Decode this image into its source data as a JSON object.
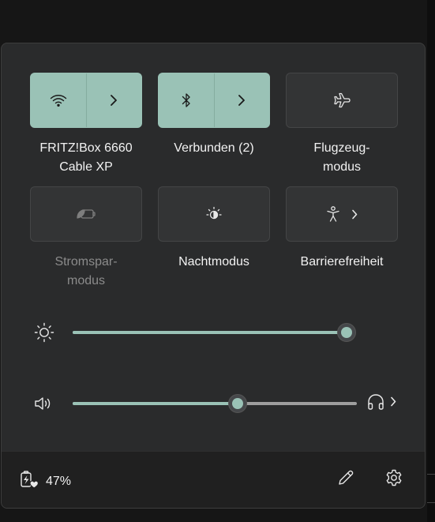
{
  "quick_settings": {
    "wifi": {
      "label": "FRITZ!Box 6660\nCable XP",
      "line1": "FRITZ!Box 6660",
      "line2": "Cable XP",
      "icon": "wifi-icon",
      "active": true
    },
    "bluetooth": {
      "label": "Verbunden (2)",
      "icon": "bluetooth-icon",
      "active": true
    },
    "airplane": {
      "line1": "Flugzeug-",
      "line2": "modus",
      "icon": "airplane-icon",
      "active": false
    },
    "battery_saver": {
      "line1": "Stromspar-",
      "line2": "modus",
      "icon": "battery-saver-icon",
      "active": false,
      "disabled": true
    },
    "night_light": {
      "label": "Nachtmodus",
      "icon": "night-light-icon",
      "active": false
    },
    "accessibility": {
      "label": "Barrierefreiheit",
      "icon": "accessibility-icon",
      "active": false
    }
  },
  "sliders": {
    "brightness": {
      "icon": "brightness-icon",
      "value": 1.0
    },
    "volume": {
      "icon": "speaker-icon",
      "value": 0.58,
      "output_icon": "headphones-icon"
    }
  },
  "footer": {
    "battery_percent": "47%",
    "battery_icon": "battery-charging-icon",
    "edit_icon": "pencil-icon",
    "settings_icon": "gear-icon"
  },
  "colors": {
    "accent": "#9ac2b6",
    "panel": "#2a2b2c",
    "footer": "#202020"
  }
}
